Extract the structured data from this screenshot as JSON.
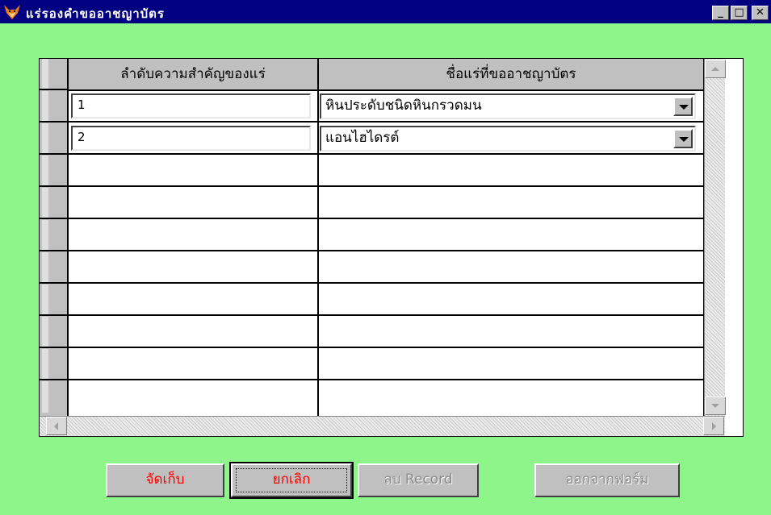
{
  "window": {
    "title": "แร่รองคำขออาชญาบัตร",
    "controls": {
      "minimize": "_",
      "maximize": "□",
      "close": "✕"
    },
    "app_icon": "fox-head-icon"
  },
  "grid": {
    "columns": [
      {
        "label": "ลำดับความสำคัญของแร่"
      },
      {
        "label": "ชื่อแร่ที่ขออาชญาบัตร"
      }
    ],
    "rows": [
      {
        "order": "1",
        "mineral": "หินประดับชนิดหินกรวดมน"
      },
      {
        "order": "2",
        "mineral": "แอนไฮไดรต์"
      }
    ],
    "empty_rows": 8
  },
  "buttons": {
    "save": "จัดเก็บ",
    "cancel": "ยกเลิก",
    "delete": "ลบ Record",
    "exit": "ออกจากฟอร์ม"
  },
  "colors": {
    "background": "#8ef58a",
    "titlebar": "#000080",
    "active_button_text": "#ff0000",
    "disabled_button_text": "#8a8a8a"
  }
}
